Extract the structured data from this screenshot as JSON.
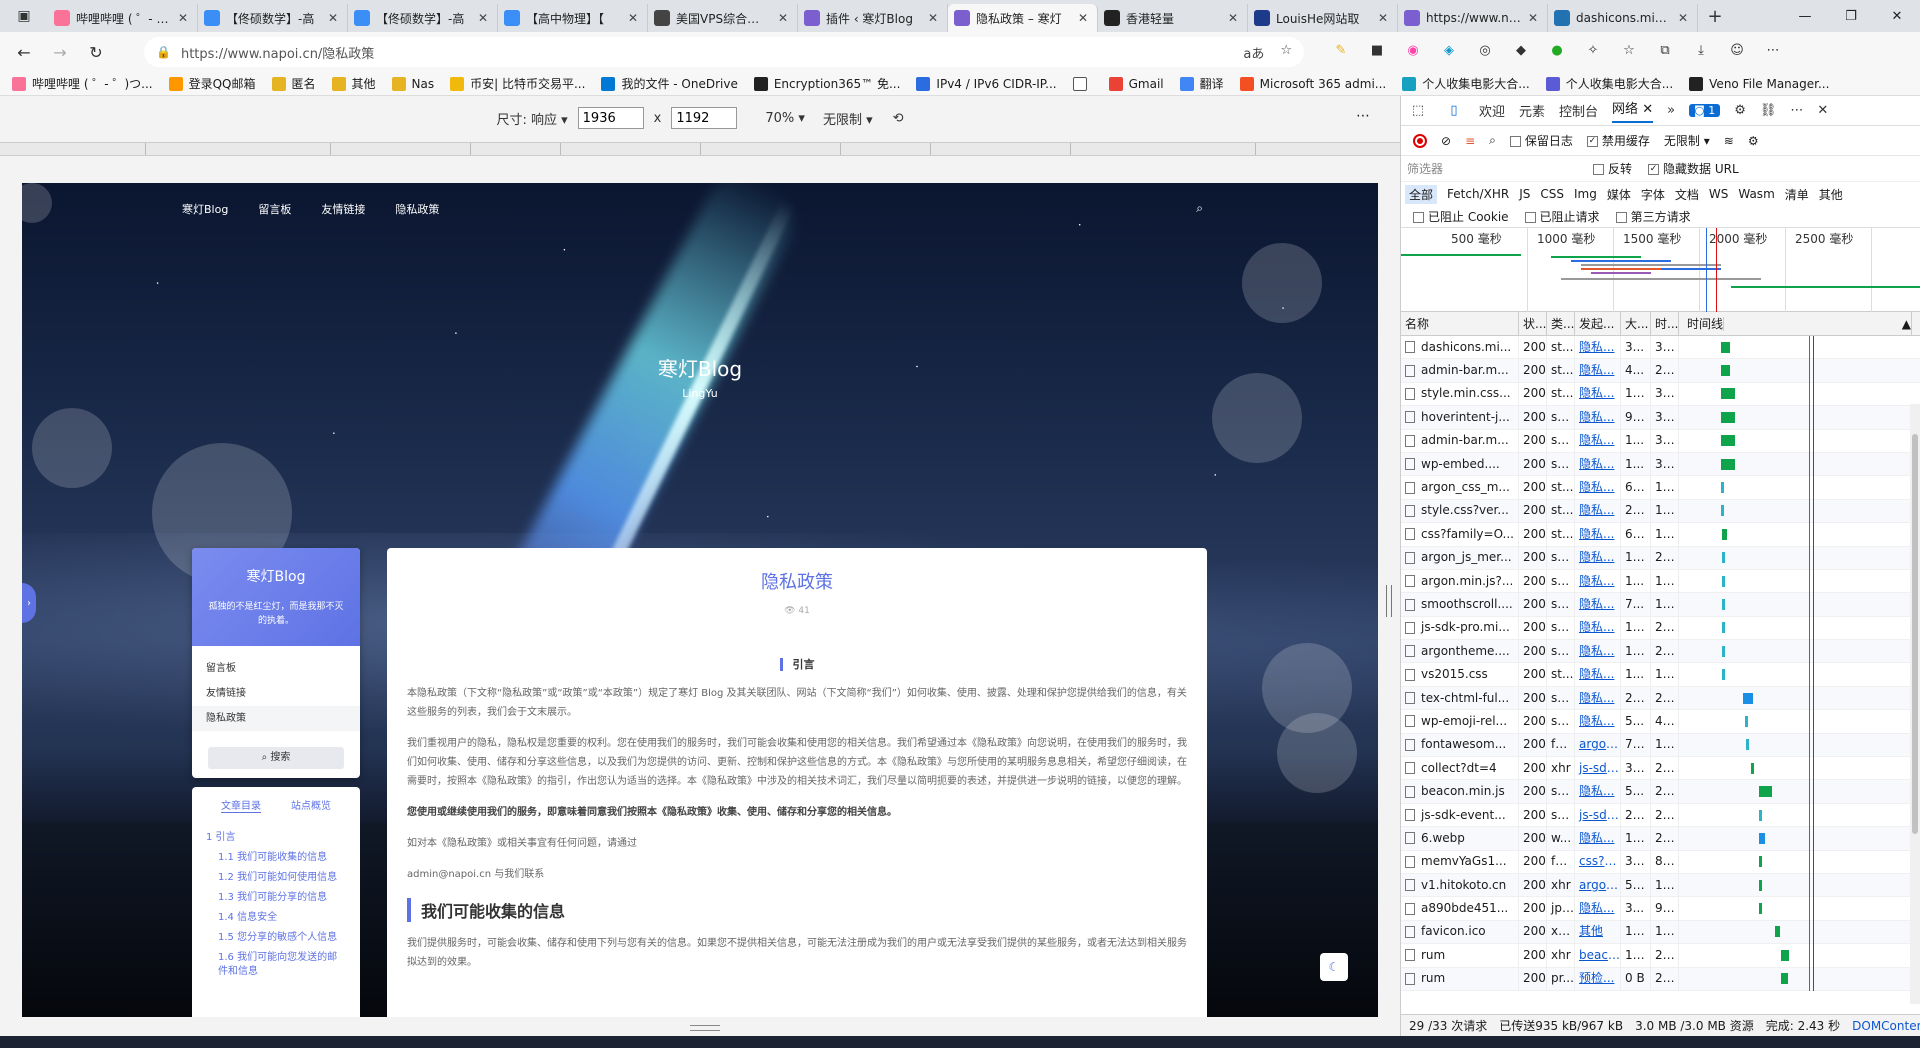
{
  "tabs": [
    {
      "title": "哔哩哔哩 ( ゜- ゜)つロ 干杯~-bilibili",
      "color": "#fb7299",
      "icon": "bilibili-icon"
    },
    {
      "title": "【佟硕数学】-高",
      "color": "#3a8ef6",
      "icon": "tv-icon"
    },
    {
      "title": "【佟硕数学】-高",
      "color": "#3a8ef6",
      "icon": "tv-icon"
    },
    {
      "title": "【高中物理】【",
      "color": "#3a8ef6",
      "icon": "tv-icon"
    },
    {
      "title": "美国VPS综合讨论",
      "color": "#444",
      "icon": "shield-icon"
    },
    {
      "title": "插件 ‹ 寒灯Blog",
      "color": "#7b5fcf",
      "icon": "plugin-icon"
    },
    {
      "title": "隐私政策 – 寒灯",
      "color": "#7b5fcf",
      "icon": "blog-icon",
      "active": true
    },
    {
      "title": "香港轻量",
      "color": "#222",
      "icon": "bt-icon"
    },
    {
      "title": "LouisHe网站取",
      "color": "#1e3a8a",
      "icon": "site-icon"
    },
    {
      "title": "https://www.nap",
      "color": "#7b5fcf",
      "icon": "blog-icon"
    },
    {
      "title": "dashicons.min.c",
      "color": "#2271b1",
      "icon": "wordpress-icon"
    }
  ],
  "address": {
    "url": "https://www.napoi.cn/隐私政策"
  },
  "bookmarks": [
    "哔哩哔哩 ( ゜- ゜)つ...",
    "登录QQ邮箱",
    "匿名",
    "其他",
    "Nas",
    "币安| 比特币交易平...",
    "我的文件 - OneDrive",
    "Encryption365™ 免...",
    "IPv4 / IPv6 CIDR-IP...",
    "",
    "Gmail",
    "翻译",
    "Microsoft 365 admi...",
    "个人收集电影大合...",
    "个人收集电影大合...",
    "Veno File Manager..."
  ],
  "device": {
    "size_label": "尺寸: 响应",
    "width": "1936",
    "height": "1192",
    "times": "x",
    "zoom": "70%",
    "throttle": "无限制"
  },
  "site": {
    "nav": [
      "寒灯Blog",
      "留言板",
      "友情链接",
      "隐私政策"
    ],
    "title": "寒灯Blog",
    "subtitle": "LingYu",
    "card_name": "寒灯Blog",
    "card_desc": "孤独的不是红尘灯，而是我那不灭的执着。",
    "menu": [
      "留言板",
      "友情链接",
      "隐私政策"
    ],
    "search_label": "搜索",
    "toc_tabs": [
      "文章目录",
      "站点概览"
    ],
    "toc": [
      {
        "text": "1 引言",
        "sub": false
      },
      {
        "text": "1.1 我们可能收集的信息",
        "sub": true
      },
      {
        "text": "1.2 我们可能如何使用信息",
        "sub": true
      },
      {
        "text": "1.3 我们可能分享的信息",
        "sub": true
      },
      {
        "text": "1.4 信息安全",
        "sub": true
      },
      {
        "text": "1.5 您分享的敏感个人信息",
        "sub": true
      },
      {
        "text": "1.6 我们可能向您发送的邮件和信息",
        "sub": true
      }
    ],
    "article": {
      "title": "隐私政策",
      "views": "41",
      "h3": "引言",
      "p1": "本隐私政策（下文称“隐私政策”或“政策”或“本政策”）规定了寒灯 Blog 及其关联团队、网站（下文简称“我们”）如何收集、使用、披露、处理和保护您提供给我们的信息，有关这些服务的列表，我们会于文末展示。",
      "p2": "我们重视用户的隐私，隐私权是您重要的权利。您在使用我们的服务时，我们可能会收集和使用您的相关信息。我们希望通过本《隐私政策》向您说明，在使用我们的服务时，我们如何收集、使用、储存和分享这些信息，以及我们为您提供的访问、更新、控制和保护这些信息的方式。本《隐私政策》与您所使用的某明服务息息相关，希望您仔细阅读，在需要时，按照本《隐私政策》的指引，作出您认为适当的选择。本《隐私政策》中涉及的相关技术词汇，我们尽量以简明扼要的表述，并提供进一步说明的链接，以便您的理解。",
      "p3": "您使用或继续使用我们的服务，即意味着同意我们按照本《隐私政策》收集、使用、储存和分享您的相关信息。",
      "p4": "如对本《隐私政策》或相关事宜有任何问题，请通过",
      "p5": "admin@napoi.cn 与我们联系",
      "h2": "我们可能收集的信息",
      "p6": "我们提供服务时，可能会收集、储存和使用下列与您有关的信息。如果您不提供相关信息，可能无法注册成为我们的用户或无法享受我们提供的某些服务，或者无法达到相关服务拟达到的效果。"
    }
  },
  "devtools": {
    "tabs": [
      "欢迎",
      "元素",
      "控制台",
      "网络",
      "»"
    ],
    "issues": "1",
    "toolbar": {
      "preserve_log": "保留日志",
      "disable_cache": "禁用缓存",
      "throttle": "无限制"
    },
    "filter_placeholder": "筛选器",
    "invert": "反转",
    "hide_data_url": "隐藏数据 URL",
    "types": [
      "全部",
      "Fetch/XHR",
      "JS",
      "CSS",
      "Img",
      "媒体",
      "字体",
      "文档",
      "WS",
      "Wasm",
      "清单",
      "其他"
    ],
    "block": [
      "已阻止 Cookie",
      "已阻止请求",
      "第三方请求"
    ],
    "overview_labels": [
      "500 毫秒",
      "1000 毫秒",
      "1500 毫秒",
      "2000 毫秒",
      "2500 毫秒"
    ],
    "columns": [
      "名称",
      "状...",
      "类...",
      "发起...",
      "大...",
      "时...",
      "时间线"
    ],
    "rows": [
      {
        "name": "dashicons.mi...",
        "status": "200",
        "type": "st...",
        "init": "隐私...",
        "size": "3...",
        "time": "36...",
        "wf": 0.26,
        "ww": 0.06
      },
      {
        "name": "admin-bar.m...",
        "status": "200",
        "type": "st...",
        "init": "隐私...",
        "size": "4...",
        "time": "23...",
        "wf": 0.26,
        "ww": 0.06
      },
      {
        "name": "style.min.css...",
        "status": "200",
        "type": "st...",
        "init": "隐私...",
        "size": "13...",
        "time": "36...",
        "wf": 0.26,
        "ww": 0.09
      },
      {
        "name": "hoverintent-j...",
        "status": "200",
        "type": "sc...",
        "init": "隐私...",
        "size": "95...",
        "time": "35...",
        "wf": 0.26,
        "ww": 0.09
      },
      {
        "name": "admin-bar.m...",
        "status": "200",
        "type": "sc...",
        "init": "隐私...",
        "size": "1...",
        "time": "35...",
        "wf": 0.26,
        "ww": 0.09
      },
      {
        "name": "wp-embed....",
        "status": "200",
        "type": "sc...",
        "init": "隐私...",
        "size": "1...",
        "time": "35...",
        "wf": 0.26,
        "ww": 0.09
      },
      {
        "name": "argon_css_m...",
        "status": "200",
        "type": "st...",
        "init": "隐私...",
        "size": "64...",
        "time": "11...",
        "wf": 0.26,
        "ww": 0.01
      },
      {
        "name": "style.css?ver...",
        "status": "200",
        "type": "st...",
        "init": "隐私...",
        "size": "28...",
        "time": "14...",
        "wf": 0.26,
        "ww": 0.01
      },
      {
        "name": "css?family=O...",
        "status": "200",
        "type": "st...",
        "init": "隐私...",
        "size": "62...",
        "time": "10...",
        "wf": 0.27,
        "ww": 0.03
      },
      {
        "name": "argon_js_mer...",
        "status": "200",
        "type": "sc...",
        "init": "隐私...",
        "size": "18...",
        "time": "25...",
        "wf": 0.27,
        "ww": 0.01
      },
      {
        "name": "argon.min.js?...",
        "status": "200",
        "type": "sc...",
        "init": "隐私...",
        "size": "1...",
        "time": "16...",
        "wf": 0.27,
        "ww": 0.01
      },
      {
        "name": "smoothscroll....",
        "status": "200",
        "type": "sc...",
        "init": "隐私...",
        "size": "7...",
        "time": "16...",
        "wf": 0.27,
        "ww": 0.01
      },
      {
        "name": "js-sdk-pro.mi...",
        "status": "200",
        "type": "sc...",
        "init": "隐私...",
        "size": "12...",
        "time": "20...",
        "wf": 0.27,
        "ww": 0.01
      },
      {
        "name": "argontheme....",
        "status": "200",
        "type": "sc...",
        "init": "隐私...",
        "size": "18...",
        "time": "21...",
        "wf": 0.27,
        "ww": 0.01
      },
      {
        "name": "vs2015.css",
        "status": "200",
        "type": "st...",
        "init": "隐私...",
        "size": "1...",
        "time": "16...",
        "wf": 0.27,
        "ww": 0.01
      },
      {
        "name": "tex-chtml-ful...",
        "status": "200",
        "type": "sc...",
        "init": "隐私...",
        "size": "21...",
        "time": "22...",
        "wf": 0.4,
        "ww": 0.06,
        "blue": true
      },
      {
        "name": "wp-emoji-rel...",
        "status": "200",
        "type": "sc...",
        "init": "隐私...",
        "size": "5...",
        "time": "48...",
        "wf": 0.41,
        "ww": 0.01
      },
      {
        "name": "fontawesom...",
        "status": "200",
        "type": "font",
        "init": "argon...",
        "size": "77...",
        "time": "12...",
        "wf": 0.42,
        "ww": 0.01
      },
      {
        "name": "collect?dt=4",
        "status": "200",
        "type": "xhr",
        "init": "js-sdk-...",
        "size": "39...",
        "time": "25...",
        "wf": 0.45,
        "ww": 0.02
      },
      {
        "name": "beacon.min.js",
        "status": "200",
        "type": "sc...",
        "init": "隐私...",
        "size": "5...",
        "time": "29...",
        "wf": 0.5,
        "ww": 0.08
      },
      {
        "name": "js-sdk-event...",
        "status": "200",
        "type": "sc...",
        "init": "js-sdk-...",
        "size": "23...",
        "time": "27...",
        "wf": 0.5,
        "ww": 0.01
      },
      {
        "name": "6.webp",
        "status": "200",
        "type": "w...",
        "init": "隐私...",
        "size": "11...",
        "time": "26...",
        "wf": 0.5,
        "ww": 0.04,
        "blue": true
      },
      {
        "name": "memvYaGs1...",
        "status": "200",
        "type": "font",
        "init": "css?fa...",
        "size": "39...",
        "time": "88...",
        "wf": 0.5,
        "ww": 0.02
      },
      {
        "name": "v1.hitokoto.cn",
        "status": "200",
        "type": "xhr",
        "init": "argon...",
        "size": "50...",
        "time": "12...",
        "wf": 0.5,
        "ww": 0.02
      },
      {
        "name": "a890bde451...",
        "status": "200",
        "type": "jpeg",
        "init": "隐私...",
        "size": "3...",
        "time": "98...",
        "wf": 0.5,
        "ww": 0.02
      },
      {
        "name": "favicon.ico",
        "status": "200",
        "type": "x-i...",
        "init": "其他",
        "size": "17...",
        "time": "13...",
        "wf": 0.6,
        "ww": 0.03
      },
      {
        "name": "rum",
        "status": "200",
        "type": "xhr",
        "init": "beaco...",
        "size": "10...",
        "time": "28...",
        "wf": 0.64,
        "ww": 0.05
      },
      {
        "name": "rum",
        "status": "200",
        "type": "pr...",
        "init": "预检...",
        "size": "0 B",
        "time": "26...",
        "wf": 0.64,
        "ww": 0.04
      }
    ],
    "status_bar": {
      "requests": "29 /33 次请求",
      "transferred": "已传送935 kB/967 kB",
      "resources": "3.0 MB /3.0 MB 资源",
      "finish": "完成: 2.43 秒",
      "dom": "DOMConten"
    }
  }
}
